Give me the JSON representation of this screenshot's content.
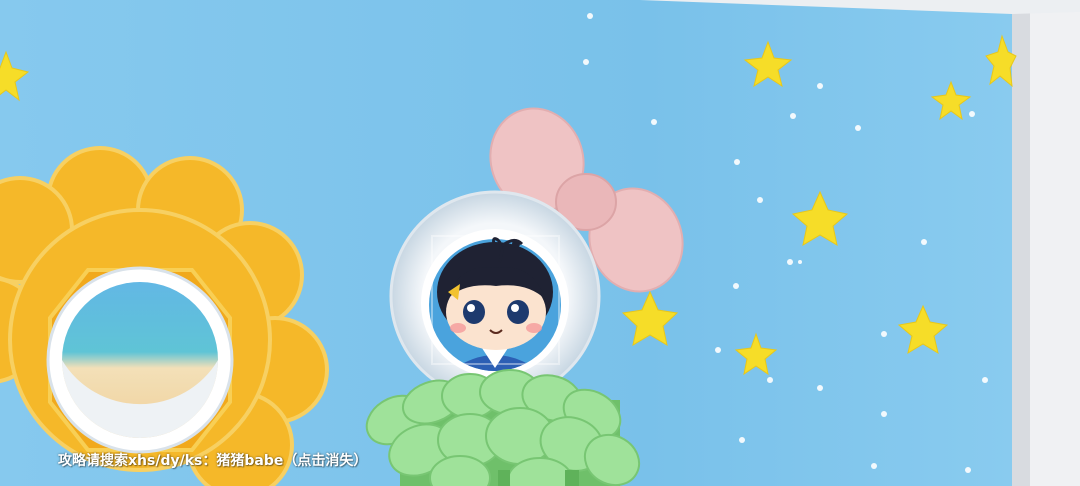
{
  "game": {
    "hint_text": "攻略请搜索xhs/dy/ks：猪猪babe（点击消失）"
  },
  "colors": {
    "wall_blue": "#7cc4ec",
    "frame_white": "#eef0f3",
    "flower_yellow": "#f5b829",
    "star_yellow": "#f6dd28",
    "bow_pink": "#efc3c4",
    "leaf_green": "#8fdc8a"
  }
}
